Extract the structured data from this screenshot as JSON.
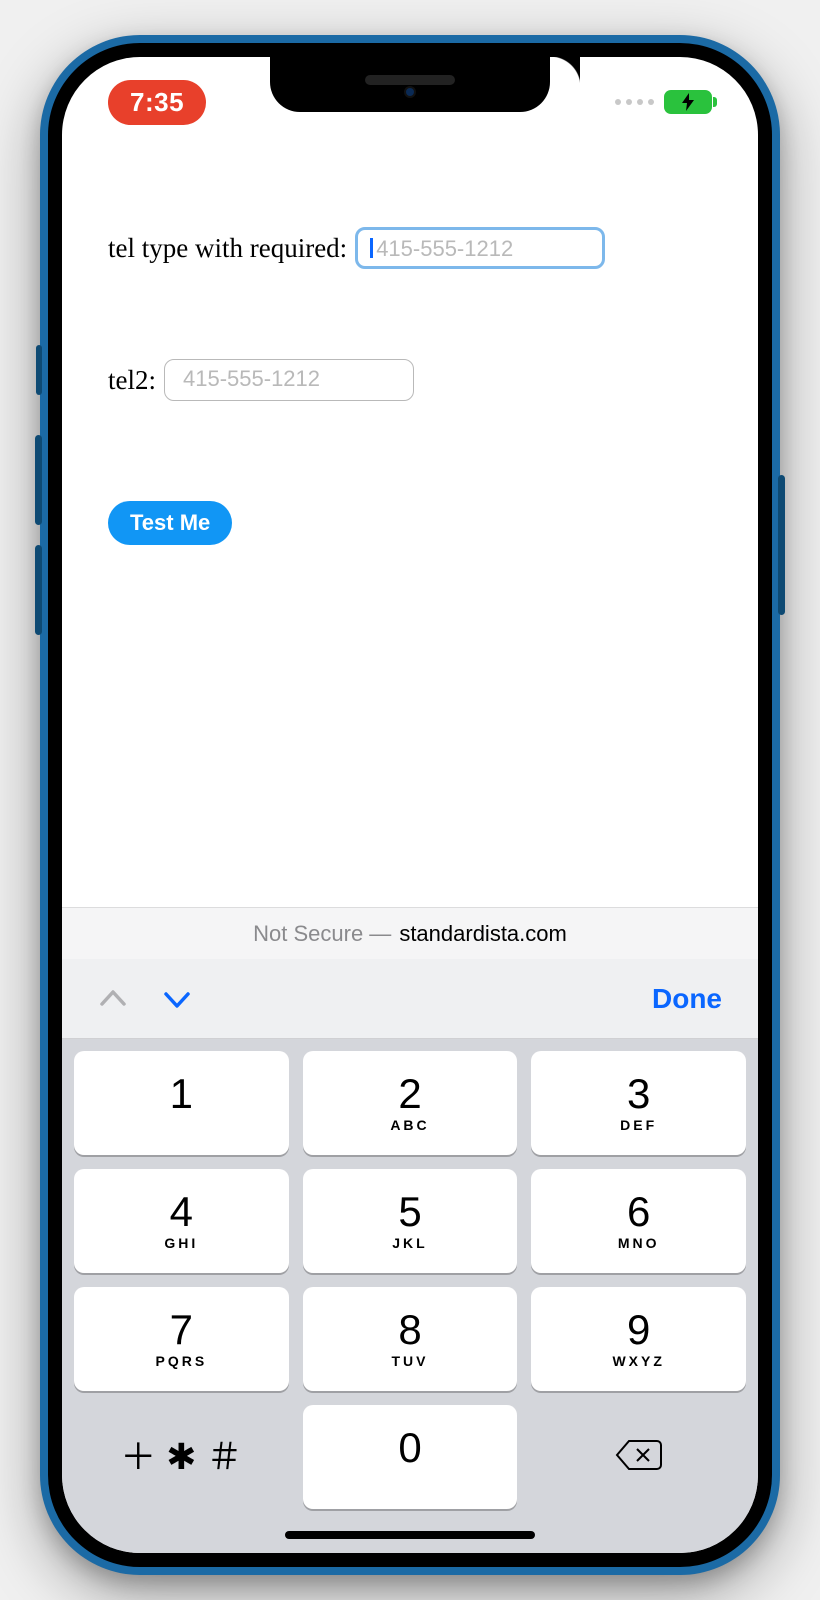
{
  "status": {
    "time": "7:35"
  },
  "form": {
    "field1_label": "tel type with required:",
    "field1_placeholder": "415-555-1212",
    "field2_label": "tel2:",
    "field2_placeholder": "415-555-1212",
    "submit_label": "Test Me"
  },
  "urlbar": {
    "prefix": "Not Secure —",
    "domain": "standardista.com"
  },
  "kbacc": {
    "done": "Done"
  },
  "keypad": {
    "k1": {
      "num": "1",
      "letters": ""
    },
    "k2": {
      "num": "2",
      "letters": "ABC"
    },
    "k3": {
      "num": "3",
      "letters": "DEF"
    },
    "k4": {
      "num": "4",
      "letters": "GHI"
    },
    "k5": {
      "num": "5",
      "letters": "JKL"
    },
    "k6": {
      "num": "6",
      "letters": "MNO"
    },
    "k7": {
      "num": "7",
      "letters": "PQRS"
    },
    "k8": {
      "num": "8",
      "letters": "TUV"
    },
    "k9": {
      "num": "9",
      "letters": "WXYZ"
    },
    "sym": {
      "num": "＋ ✱ ＃"
    },
    "k0": {
      "num": "0",
      "letters": ""
    }
  }
}
